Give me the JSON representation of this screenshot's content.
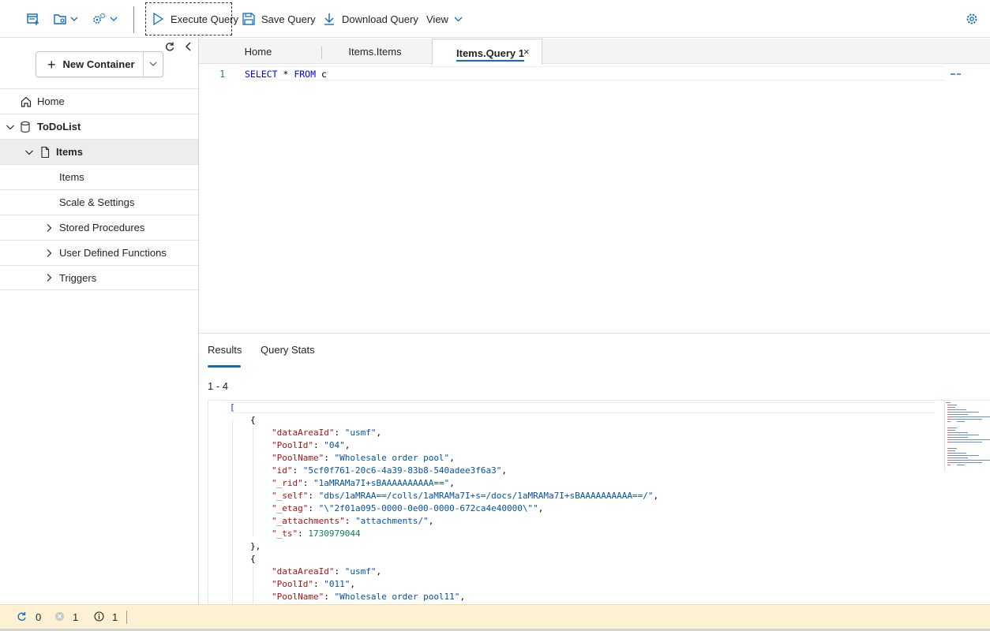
{
  "toolbar": {
    "execute_label": "Execute Query",
    "save_label": "Save Query",
    "download_label": "Download Query",
    "view_label": "View"
  },
  "sidebar": {
    "new_container_label": "New Container",
    "tree": [
      {
        "label": "Home"
      },
      {
        "label": "ToDoList"
      },
      {
        "label": "Items"
      },
      {
        "label": "Items"
      },
      {
        "label": "Scale & Settings"
      },
      {
        "label": "Stored Procedures"
      },
      {
        "label": "User Defined Functions"
      },
      {
        "label": "Triggers"
      }
    ]
  },
  "tabs": [
    {
      "label": "Home"
    },
    {
      "label": "Items.Items"
    },
    {
      "label": "Items.Query 1",
      "close": "×"
    }
  ],
  "editor": {
    "line_number": "1",
    "kw_select": "SELECT",
    "op_star": " * ",
    "kw_from": "FROM",
    "alias": " c"
  },
  "results": {
    "tab_results": "Results",
    "tab_stats": "Query Stats",
    "count": "1 - 4",
    "json": {
      "open_bracket": "[",
      "item1": {
        "dataAreaId": "\"usmf\"",
        "PoolId": "\"04\"",
        "PoolName": "\"Wholesale order pool\"",
        "id": "\"5cf0f761-20c6-4a39-83b8-540adee3f6a3\"",
        "_rid": "\"1aMRAMa7I+sBAAAAAAAAAA==\"",
        "_self": "\"dbs/1aMRAA==/colls/1aMRAMa7I+s=/docs/1aMRAMa7I+sBAAAAAAAAAA==/\"",
        "_etag": "\"\\\"2f01a095-0000-0e00-0000-672ca4e40000\\\"\"",
        "_attachments": "\"attachments/\"",
        "_ts": "1730979044"
      },
      "item2": {
        "dataAreaId": "\"usmf\"",
        "PoolId": "\"011\"",
        "PoolName": "\"Wholesale order pool11\""
      }
    }
  },
  "status": {
    "refresh_count": "0",
    "error_count": "1",
    "info_count": "1"
  },
  "colors": {
    "accent": "#0f6cbd",
    "status_bar": "#fcf1d2"
  }
}
